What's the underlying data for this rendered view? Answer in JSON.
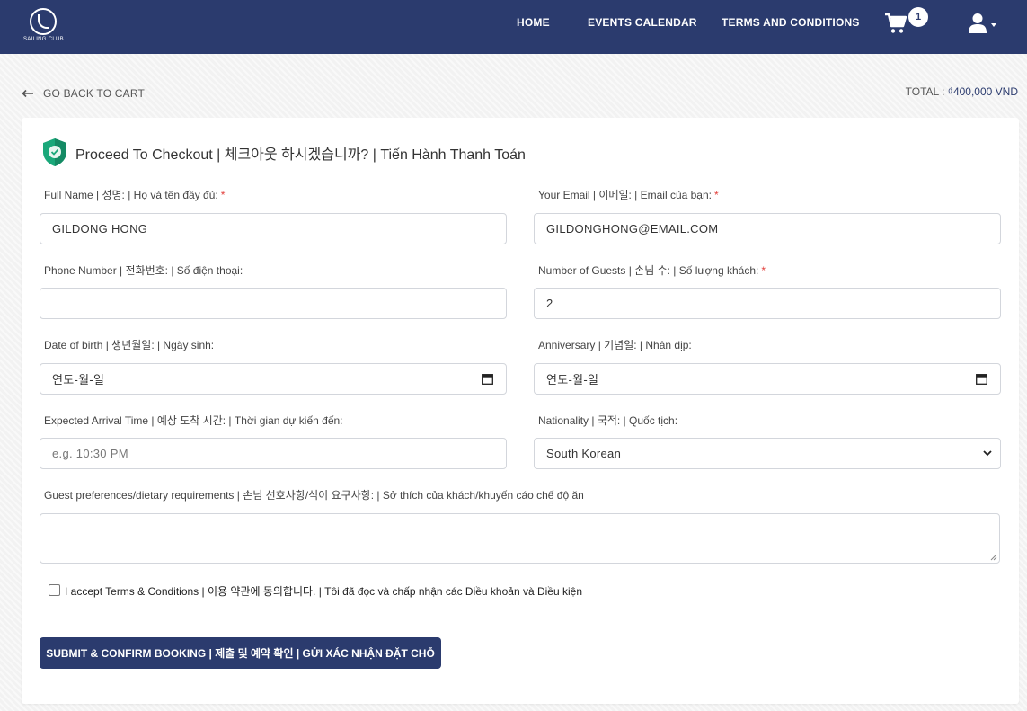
{
  "header": {
    "logo_text": "SAILING CLUB",
    "nav": {
      "home": "HOME",
      "events": "EVENTS CALENDAR",
      "terms": "TERMS AND CONDITIONS"
    },
    "cart_count": "1",
    "icons": {
      "cart": "cart-icon",
      "user": "user-icon",
      "caret": "caret-down-icon"
    }
  },
  "top": {
    "back_label": "GO BACK TO CART",
    "total_label": "TOTAL :",
    "total_amount": "₫400,000 VND"
  },
  "checkout": {
    "title": "Proceed To Checkout | 체크아웃 하시겠습니까? | Tiến Hành Thanh Toán",
    "required_mark": "*",
    "full_name": {
      "label": "Full Name | 성명: | Họ và tên đầy đủ:",
      "value": "GILDONG HONG"
    },
    "email": {
      "label": "Your Email | 이메일: | Email của bạn:",
      "value": "GILDONGHONG@EMAIL.COM"
    },
    "phone": {
      "label": "Phone Number | 전화번호: | Số điện thoại:",
      "value": ""
    },
    "guests": {
      "label": "Number of Guests | 손님 수: | Số lượng khách:",
      "value": "2"
    },
    "dob": {
      "label": "Date of birth | 생년월일: | Ngày sinh:",
      "value": "연도-월-일"
    },
    "anniversary": {
      "label": "Anniversary | 기념일: | Nhân dịp:",
      "value": "연도-월-일"
    },
    "arrival": {
      "label": "Expected Arrival Time | 예상 도착 시간: | Thời gian dự kiến đến:",
      "placeholder": "e.g. 10:30 PM"
    },
    "nationality": {
      "label": "Nationality | 국적: | Quốc tịch:",
      "selected": "South Korean"
    },
    "preferences": {
      "label": "Guest preferences/dietary requirements | 손님 선호사항/식이 요구사항: | Sở thích của khách/khuyến cáo chế độ ăn",
      "value": ""
    },
    "terms_label": "I accept Terms & Conditions | 이용 약관에 동의합니다. | Tôi đã đọc và chấp nhận các Điều khoản và Điều kiện",
    "submit_label": "SUBMIT & CONFIRM BOOKING | 제출 및 예약 확인 | GỬI XÁC NHẬN ĐẶT CHỖ"
  },
  "colors": {
    "navbar": "#2b3b6e",
    "accent": "#2b3b6e",
    "shield": "#1aa87a",
    "required": "#e2403c"
  }
}
